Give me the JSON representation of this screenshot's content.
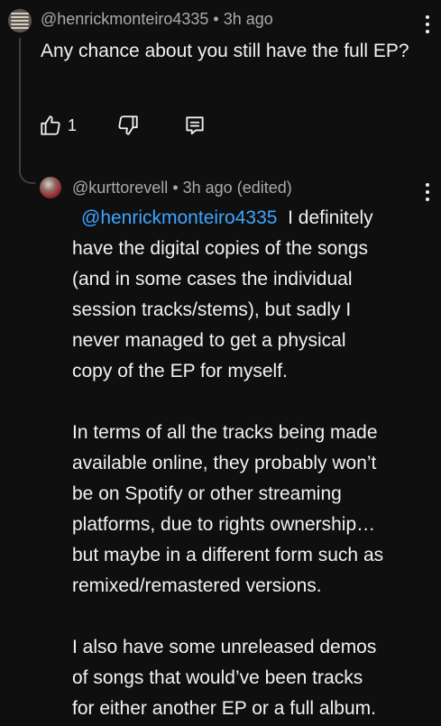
{
  "parent_comment": {
    "handle": "@henrickmonteiro4335",
    "time": "3h ago",
    "text": "Any chance about you still have the full EP?",
    "like_count": "1"
  },
  "reply_comment": {
    "handle": "@kurttorevell",
    "time": "3h ago",
    "edited": "(edited)",
    "mention": "@henrickmonteiro4335",
    "paragraph1_lines": [
      "I definitely",
      "have the digital copies of the songs",
      "(and in some cases the individual",
      "session tracks/stems), but sadly I",
      "never managed to get a physical",
      "copy of the EP for myself."
    ],
    "paragraph2_lines": [
      "In terms of all the tracks being made",
      "available online, they probably won’t",
      "be on Spotify or other streaming",
      "platforms, due to rights ownership…",
      "but maybe in a different form such as",
      "remixed/remastered versions."
    ],
    "paragraph3_lines": [
      "I also have some unreleased demos",
      "of songs that would’ve been tracks",
      "for either another EP or a full album."
    ]
  },
  "icons": {
    "like": "thumbs-up-icon",
    "dislike": "thumbs-down-icon",
    "reply": "reply-comment-icon",
    "more": "more-vertical-icon"
  },
  "colors": {
    "background": "#0f0f0f",
    "text": "#f1f1f1",
    "meta": "#aaaaaa",
    "mention": "#3ea6ff"
  }
}
